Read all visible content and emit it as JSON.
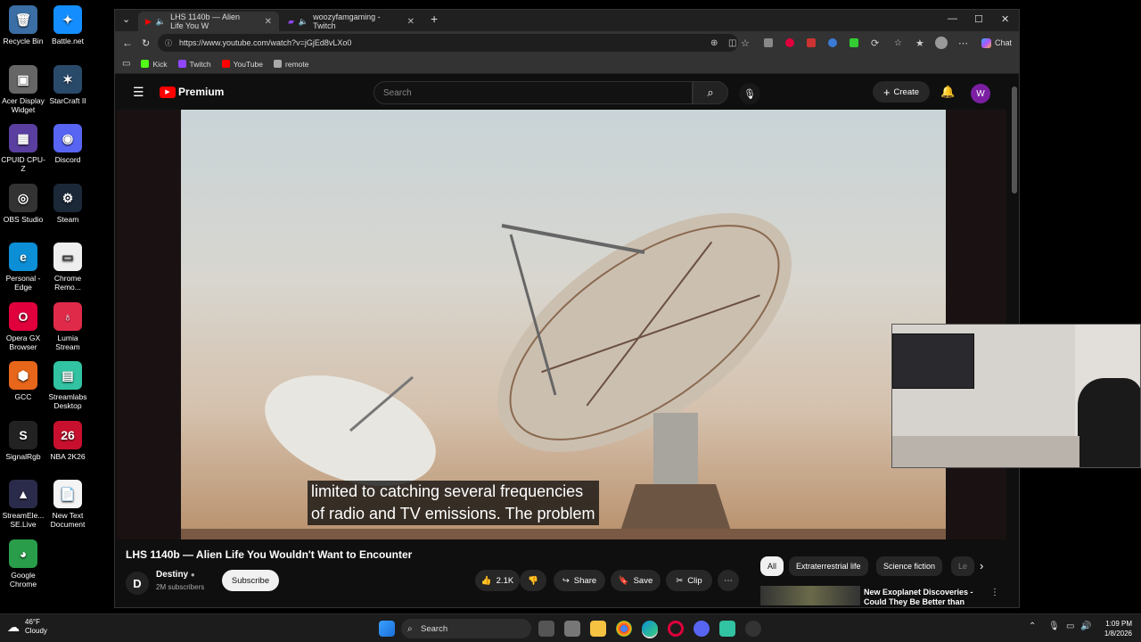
{
  "desktop": {
    "icons": [
      {
        "label": "Recycle Bin",
        "color": "#3a6ea5",
        "glyph": "🗑"
      },
      {
        "label": "Battle.net",
        "color": "#148eff",
        "glyph": "✦"
      },
      {
        "label": "Acer Display Widget",
        "color": "#666666",
        "glyph": "▣"
      },
      {
        "label": "StarCraft II",
        "color": "#2a4a6a",
        "glyph": "✶"
      },
      {
        "label": "CPUID CPU-Z",
        "color": "#5a3fa0",
        "glyph": "▦"
      },
      {
        "label": "Discord",
        "color": "#5865f2",
        "glyph": "◉"
      },
      {
        "label": "OBS Studio",
        "color": "#333333",
        "glyph": "◎"
      },
      {
        "label": "Steam",
        "color": "#1b2838",
        "glyph": "⚙"
      },
      {
        "label": "Personal - Edge",
        "color": "#0c8fd6",
        "glyph": "e"
      },
      {
        "label": "Chrome Remo...",
        "color": "#eeeeee",
        "glyph": "▭"
      },
      {
        "label": "Opera GX Browser",
        "color": "#e0003c",
        "glyph": "O"
      },
      {
        "label": "Lumia Stream",
        "color": "#e02a4a",
        "glyph": "♁"
      },
      {
        "label": "GCC",
        "color": "#e8661a",
        "glyph": "⬢"
      },
      {
        "label": "Streamlabs Desktop",
        "color": "#31c3a2",
        "glyph": "▤"
      },
      {
        "label": "SignalRgb",
        "color": "#222222",
        "glyph": "S"
      },
      {
        "label": "NBA 2K26",
        "color": "#c8102e",
        "glyph": "26"
      },
      {
        "label": "StreamEle... SE.Live",
        "color": "#2a2a4a",
        "glyph": "▲"
      },
      {
        "label": "New Text Document",
        "color": "#f4f4f4",
        "glyph": "📄"
      },
      {
        "label": "Google Chrome",
        "color": "#2a9d4a",
        "glyph": "◕"
      }
    ]
  },
  "browser": {
    "tabs": [
      {
        "title": "LHS 1140b — Alien Life You W",
        "active": true
      },
      {
        "title": "woozyfamgaming - Twitch",
        "active": false
      }
    ],
    "new_tab_glyph": "+",
    "url": "https://www.youtube.com/watch?v=jGjEd8vLXo0",
    "chat_label": "Chat",
    "bookmarks": [
      {
        "label": "Kick",
        "color": "#53fc18"
      },
      {
        "label": "Twitch",
        "color": "#9146ff"
      },
      {
        "label": "YouTube",
        "color": "#ff0000"
      },
      {
        "label": "remote",
        "color": "#aaaaaa"
      }
    ]
  },
  "youtube": {
    "logo_text": "Premium",
    "search_placeholder": "Search",
    "create_label": "Create",
    "avatar_letter": "W",
    "caption_line1": "limited to catching several frequencies",
    "caption_line2": "of radio and TV emissions. The problem",
    "video_title": "LHS 1140b — Alien Life You Wouldn't Want to Encounter",
    "channel_name": "Destiny",
    "subscribers": "2M subscribers",
    "subscribe_label": "Subscribe",
    "likes": "2.1K",
    "share_label": "Share",
    "save_label": "Save",
    "clip_label": "Clip",
    "chips": [
      "All",
      "Extraterrestrial life",
      "Science fiction",
      "Le"
    ],
    "rec_title_line1": "New Exoplanet Discoveries -",
    "rec_title_line2": "Could They Be Better than"
  },
  "taskbar": {
    "weather_temp": "46°F",
    "weather_desc": "Cloudy",
    "search_label": "Search",
    "time": "1:09 PM",
    "date": "1/8/2026"
  }
}
